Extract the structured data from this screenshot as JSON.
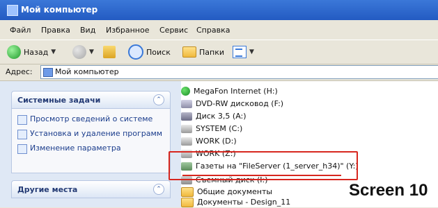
{
  "window": {
    "title": "Мой компьютер"
  },
  "menu": [
    "Файл",
    "Правка",
    "Вид",
    "Избранное",
    "Сервис",
    "Справка"
  ],
  "toolbar": {
    "back_label": "Назад",
    "search_label": "Поиск",
    "folders_label": "Папки",
    "icons": {
      "back": "back-arrow-icon",
      "forward": "forward-arrow-icon",
      "up": "folder-up-icon",
      "search": "search-icon",
      "folders": "folders-icon",
      "views": "views-icon"
    }
  },
  "address": {
    "label": "Адрес:",
    "value": "Мой компьютер"
  },
  "left_panels": {
    "system_tasks": {
      "title": "Системные задачи",
      "items": [
        "Просмотр сведений о системе",
        "Установка и удаление программ",
        "Изменение параметра"
      ]
    },
    "other_places": {
      "title": "Другие места"
    }
  },
  "drives": [
    {
      "name": "MegaFon Internet (H:)",
      "icon": "globe-icon"
    },
    {
      "name": "DVD-RW дисковод (F:)",
      "icon": "dvd-drive-icon"
    },
    {
      "name": "Диск 3,5 (A:)",
      "icon": "floppy-icon"
    },
    {
      "name": "SYSTEM (C:)",
      "icon": "hard-drive-icon"
    },
    {
      "name": "WORK (D:)",
      "icon": "hard-drive-icon"
    },
    {
      "name": "WORK (Z:)",
      "icon": "hard-drive-icon"
    },
    {
      "name": "Газеты на \"FileServer (1_server_h34)\" (Y:)",
      "icon": "network-drive-icon"
    },
    {
      "name": "Съемный диск (I:)",
      "icon": "removable-drive-icon"
    },
    {
      "name": "Общие документы",
      "icon": "folder-icon"
    },
    {
      "name": "Документы - Design_11",
      "icon": "folder-icon"
    }
  ],
  "annotation": {
    "label": "Screen 10",
    "highlight_color": "#d7261e"
  }
}
